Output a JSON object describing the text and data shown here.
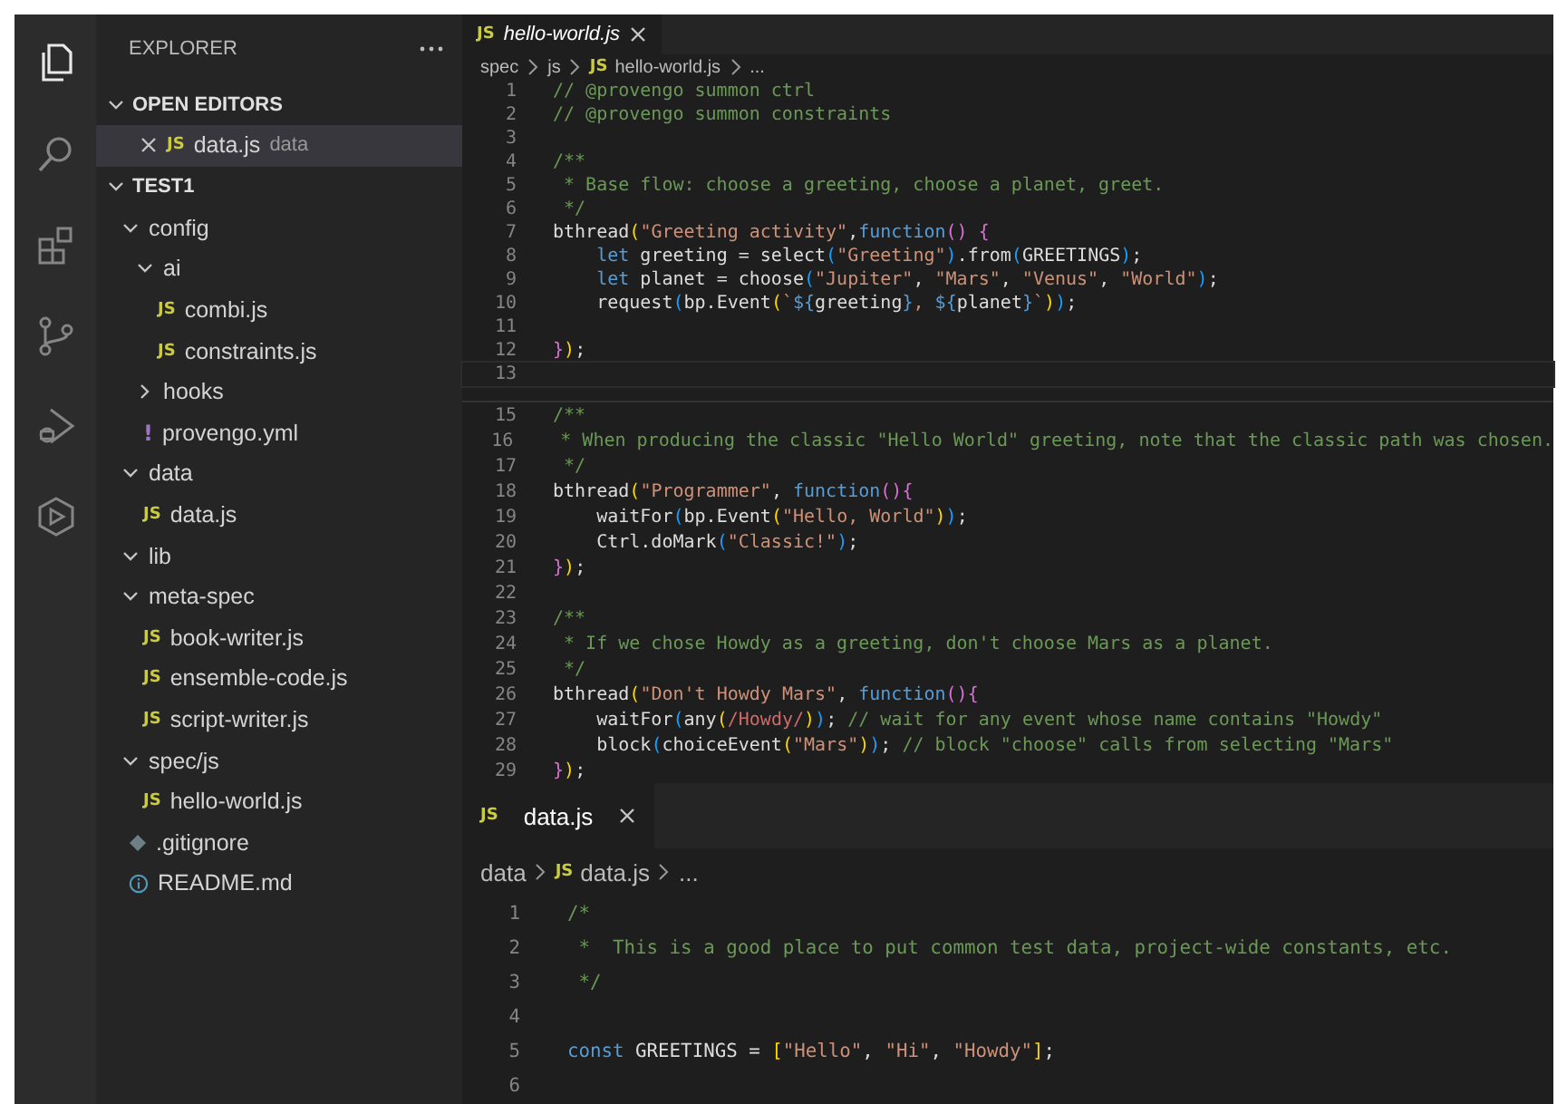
{
  "activity_bar": {
    "items": [
      {
        "kind": "files",
        "selected": true
      },
      {
        "kind": "search",
        "selected": false
      },
      {
        "kind": "extensions",
        "selected": false
      },
      {
        "kind": "source-control",
        "selected": false
      },
      {
        "kind": "run-debug",
        "selected": false
      },
      {
        "kind": "hexagon",
        "selected": false
      }
    ]
  },
  "sidebar": {
    "title": "EXPLORER",
    "sections": [
      {
        "title": "OPEN EDITORS",
        "expanded": true,
        "kind": "open-editors",
        "items": [
          {
            "label": "data.js",
            "description": "data",
            "kind": "js",
            "icon_label": "JS",
            "selected": true
          }
        ]
      },
      {
        "title": "TEST1",
        "expanded": true,
        "kind": "tree",
        "items": [
          {
            "label": "config",
            "kind": "folder",
            "expanded": true,
            "children": [
              {
                "label": "ai",
                "kind": "folder",
                "expanded": true,
                "children": [
                  {
                    "label": "combi.js",
                    "kind": "js",
                    "icon_label": "JS"
                  },
                  {
                    "label": "constraints.js",
                    "kind": "js",
                    "icon_label": "JS"
                  }
                ]
              },
              {
                "label": "hooks",
                "kind": "folder",
                "expanded": false
              },
              {
                "label": "provengo.yml",
                "kind": "yaml",
                "icon_label": "!"
              }
            ]
          },
          {
            "label": "data",
            "kind": "folder",
            "expanded": true,
            "children": [
              {
                "label": "data.js",
                "kind": "js",
                "icon_label": "JS"
              }
            ]
          },
          {
            "label": "lib",
            "kind": "folder",
            "expanded": true
          },
          {
            "label": "meta-spec",
            "kind": "folder",
            "expanded": true,
            "children": [
              {
                "label": "book-writer.js",
                "kind": "js",
                "icon_label": "JS"
              },
              {
                "label": "ensemble-code.js",
                "kind": "js",
                "icon_label": "JS"
              },
              {
                "label": "script-writer.js",
                "kind": "js",
                "icon_label": "JS"
              }
            ]
          },
          {
            "label": "spec/js",
            "kind": "folder",
            "expanded": true,
            "children": [
              {
                "label": "hello-world.js",
                "kind": "js",
                "icon_label": "JS"
              }
            ]
          },
          {
            "label": ".gitignore",
            "kind": "git"
          },
          {
            "label": "README.md",
            "kind": "info"
          }
        ]
      }
    ]
  },
  "editors": [
    {
      "kind": "top",
      "tabs": [
        {
          "label": "hello-world.js",
          "icon_label": "JS",
          "preview": true,
          "selected": true
        }
      ],
      "breadcrumbs": [
        {
          "label": "spec",
          "kind": "folder"
        },
        {
          "label": "js",
          "kind": "folder"
        },
        {
          "label": "hello-world.js",
          "kind": "file",
          "icon_label": "JS"
        },
        {
          "label": "...",
          "kind": "more"
        }
      ],
      "blocks": [
        {
          "lines": [
            {
              "number": "1",
              "tokens": [
                {
                  "kind": "comment",
                  "text": "// @provengo summon ctrl"
                }
              ]
            },
            {
              "number": "2",
              "tokens": [
                {
                  "kind": "comment",
                  "text": "// @provengo summon constraints"
                }
              ]
            },
            {
              "number": "3"
            },
            {
              "number": "4",
              "tokens": [
                {
                  "kind": "comment",
                  "text": "/**"
                }
              ]
            },
            {
              "number": "5",
              "tokens": [
                {
                  "kind": "comment",
                  "text": " * Base flow: choose a greeting, choose a planet, greet."
                }
              ]
            },
            {
              "number": "6",
              "tokens": [
                {
                  "kind": "comment",
                  "text": " */"
                }
              ]
            },
            {
              "number": "7",
              "tokens": [
                {
                  "kind": "plain",
                  "text": "bthread"
                },
                {
                  "kind": "b1",
                  "text": "("
                },
                {
                  "kind": "string",
                  "text": "\"Greeting activity\""
                },
                {
                  "kind": "plain",
                  "text": ","
                },
                {
                  "kind": "keyword",
                  "text": "function"
                },
                {
                  "kind": "b2",
                  "text": "()"
                },
                {
                  "kind": "b2",
                  "text": " {"
                }
              ]
            },
            {
              "number": "8",
              "tokens": [
                {
                  "kind": "keyword",
                  "text": "    let"
                },
                {
                  "kind": "plain",
                  "text": " greeting = select"
                },
                {
                  "kind": "b3",
                  "text": "("
                },
                {
                  "kind": "string",
                  "text": "\"Greeting\""
                },
                {
                  "kind": "b3",
                  "text": ")"
                },
                {
                  "kind": "plain",
                  "text": ".from"
                },
                {
                  "kind": "b3",
                  "text": "("
                },
                {
                  "kind": "plain",
                  "text": "GREETINGS"
                },
                {
                  "kind": "b3",
                  "text": ")"
                },
                {
                  "kind": "plain",
                  "text": ";"
                }
              ]
            },
            {
              "number": "9",
              "tokens": [
                {
                  "kind": "keyword",
                  "text": "    let"
                },
                {
                  "kind": "plain",
                  "text": " planet = choose"
                },
                {
                  "kind": "b3",
                  "text": "("
                },
                {
                  "kind": "string",
                  "text": "\"Jupiter\""
                },
                {
                  "kind": "plain",
                  "text": ", "
                },
                {
                  "kind": "string",
                  "text": "\"Mars\""
                },
                {
                  "kind": "plain",
                  "text": ", "
                },
                {
                  "kind": "string",
                  "text": "\"Venus\""
                },
                {
                  "kind": "plain",
                  "text": ", "
                },
                {
                  "kind": "string",
                  "text": "\"World\""
                },
                {
                  "kind": "b3",
                  "text": ")"
                },
                {
                  "kind": "plain",
                  "text": ";"
                }
              ]
            },
            {
              "number": "10",
              "tokens": [
                {
                  "kind": "plain",
                  "text": "    request"
                },
                {
                  "kind": "b3",
                  "text": "("
                },
                {
                  "kind": "plain",
                  "text": "bp.Event"
                },
                {
                  "kind": "b1",
                  "text": "("
                },
                {
                  "kind": "string",
                  "text": "`"
                },
                {
                  "kind": "template",
                  "text": "${"
                },
                {
                  "kind": "plain",
                  "text": "greeting"
                },
                {
                  "kind": "template",
                  "text": "}"
                },
                {
                  "kind": "string",
                  "text": ", "
                },
                {
                  "kind": "template",
                  "text": "${"
                },
                {
                  "kind": "plain",
                  "text": "planet"
                },
                {
                  "kind": "template",
                  "text": "}"
                },
                {
                  "kind": "string",
                  "text": "`"
                },
                {
                  "kind": "b1",
                  "text": ")"
                },
                {
                  "kind": "b3",
                  "text": ")"
                },
                {
                  "kind": "plain",
                  "text": ";"
                }
              ]
            },
            {
              "number": "11"
            },
            {
              "number": "12",
              "tokens": [
                {
                  "kind": "b2",
                  "text": "}"
                },
                {
                  "kind": "b1",
                  "text": ")"
                },
                {
                  "kind": "plain",
                  "text": ";"
                }
              ]
            },
            {
              "number": "13",
              "current": true
            }
          ]
        },
        {
          "lines": [
            {
              "number": "15",
              "tokens": [
                {
                  "kind": "comment",
                  "text": "/**"
                }
              ]
            },
            {
              "number": "16",
              "tokens": [
                {
                  "kind": "comment",
                  "text": " * When producing the classic \"Hello World\" greeting, note that the classic path was chosen."
                }
              ]
            },
            {
              "number": "17",
              "tokens": [
                {
                  "kind": "comment",
                  "text": " */"
                }
              ]
            },
            {
              "number": "18",
              "tokens": [
                {
                  "kind": "plain",
                  "text": "bthread"
                },
                {
                  "kind": "b1",
                  "text": "("
                },
                {
                  "kind": "string",
                  "text": "\"Programmer\""
                },
                {
                  "kind": "plain",
                  "text": ", "
                },
                {
                  "kind": "keyword",
                  "text": "function"
                },
                {
                  "kind": "b2",
                  "text": "(){"
                }
              ]
            },
            {
              "number": "19",
              "tokens": [
                {
                  "kind": "plain",
                  "text": "    waitFor"
                },
                {
                  "kind": "b3",
                  "text": "("
                },
                {
                  "kind": "plain",
                  "text": "bp.Event"
                },
                {
                  "kind": "b1",
                  "text": "("
                },
                {
                  "kind": "string",
                  "text": "\"Hello, World\""
                },
                {
                  "kind": "b1",
                  "text": ")"
                },
                {
                  "kind": "b3",
                  "text": ")"
                },
                {
                  "kind": "plain",
                  "text": ";"
                }
              ]
            },
            {
              "number": "20",
              "tokens": [
                {
                  "kind": "plain",
                  "text": "    Ctrl.doMark"
                },
                {
                  "kind": "b3",
                  "text": "("
                },
                {
                  "kind": "string",
                  "text": "\"Classic!\""
                },
                {
                  "kind": "b3",
                  "text": ")"
                },
                {
                  "kind": "plain",
                  "text": ";"
                }
              ]
            },
            {
              "number": "21",
              "tokens": [
                {
                  "kind": "b2",
                  "text": "}"
                },
                {
                  "kind": "b1",
                  "text": ")"
                },
                {
                  "kind": "plain",
                  "text": ";"
                }
              ]
            },
            {
              "number": "22"
            },
            {
              "number": "23",
              "tokens": [
                {
                  "kind": "comment",
                  "text": "/**"
                }
              ]
            },
            {
              "number": "24",
              "tokens": [
                {
                  "kind": "comment",
                  "text": " * If we chose Howdy as a greeting, don't choose Mars as a planet."
                }
              ]
            },
            {
              "number": "25",
              "tokens": [
                {
                  "kind": "comment",
                  "text": " */"
                }
              ]
            },
            {
              "number": "26",
              "tokens": [
                {
                  "kind": "plain",
                  "text": "bthread"
                },
                {
                  "kind": "b1",
                  "text": "("
                },
                {
                  "kind": "string",
                  "text": "\"Don't Howdy Mars\""
                },
                {
                  "kind": "plain",
                  "text": ", "
                },
                {
                  "kind": "keyword",
                  "text": "function"
                },
                {
                  "kind": "b2",
                  "text": "(){"
                }
              ]
            },
            {
              "number": "27",
              "tokens": [
                {
                  "kind": "plain",
                  "text": "    waitFor"
                },
                {
                  "kind": "b3",
                  "text": "("
                },
                {
                  "kind": "plain",
                  "text": "any"
                },
                {
                  "kind": "b1",
                  "text": "("
                },
                {
                  "kind": "regex",
                  "text": "/Howdy/"
                },
                {
                  "kind": "b1",
                  "text": ")"
                },
                {
                  "kind": "b3",
                  "text": ")"
                },
                {
                  "kind": "plain",
                  "text": "; "
                },
                {
                  "kind": "comment",
                  "text": "// wait for any event whose name contains \"Howdy\""
                }
              ]
            },
            {
              "number": "28",
              "tokens": [
                {
                  "kind": "plain",
                  "text": "    block"
                },
                {
                  "kind": "b3",
                  "text": "("
                },
                {
                  "kind": "plain",
                  "text": "choiceEvent"
                },
                {
                  "kind": "b1",
                  "text": "("
                },
                {
                  "kind": "string",
                  "text": "\"Mars\""
                },
                {
                  "kind": "b1",
                  "text": ")"
                },
                {
                  "kind": "b3",
                  "text": ")"
                },
                {
                  "kind": "plain",
                  "text": "; "
                },
                {
                  "kind": "comment",
                  "text": "// block \"choose\" calls from selecting \"Mars\""
                }
              ]
            },
            {
              "number": "29",
              "tokens": [
                {
                  "kind": "b2",
                  "text": "}"
                },
                {
                  "kind": "b1",
                  "text": ")"
                },
                {
                  "kind": "plain",
                  "text": ";"
                }
              ]
            }
          ]
        }
      ]
    },
    {
      "kind": "bottom",
      "tabs": [
        {
          "label": "data.js",
          "icon_label": "JS",
          "preview": false,
          "selected": true
        }
      ],
      "breadcrumbs": [
        {
          "label": "data",
          "kind": "folder"
        },
        {
          "label": "data.js",
          "kind": "file",
          "icon_label": "JS"
        },
        {
          "label": "...",
          "kind": "more"
        }
      ],
      "blocks": [
        {
          "lines": [
            {
              "number": "1",
              "tokens": [
                {
                  "kind": "comment",
                  "text": "/*"
                }
              ]
            },
            {
              "number": "2",
              "tokens": [
                {
                  "kind": "comment",
                  "text": " *  This is a good place to put common test data, project-wide constants, etc."
                }
              ]
            },
            {
              "number": "3",
              "tokens": [
                {
                  "kind": "comment",
                  "text": " */"
                }
              ]
            },
            {
              "number": "4"
            },
            {
              "number": "5",
              "tokens": [
                {
                  "kind": "keyword",
                  "text": "const"
                },
                {
                  "kind": "plain",
                  "text": " GREETINGS = "
                },
                {
                  "kind": "b1",
                  "text": "["
                },
                {
                  "kind": "string",
                  "text": "\"Hello\""
                },
                {
                  "kind": "plain",
                  "text": ", "
                },
                {
                  "kind": "string",
                  "text": "\"Hi\""
                },
                {
                  "kind": "plain",
                  "text": ", "
                },
                {
                  "kind": "string",
                  "text": "\"Howdy\""
                },
                {
                  "kind": "b1",
                  "text": "]"
                },
                {
                  "kind": "plain",
                  "text": ";"
                }
              ]
            },
            {
              "number": "6"
            }
          ]
        }
      ]
    }
  ]
}
